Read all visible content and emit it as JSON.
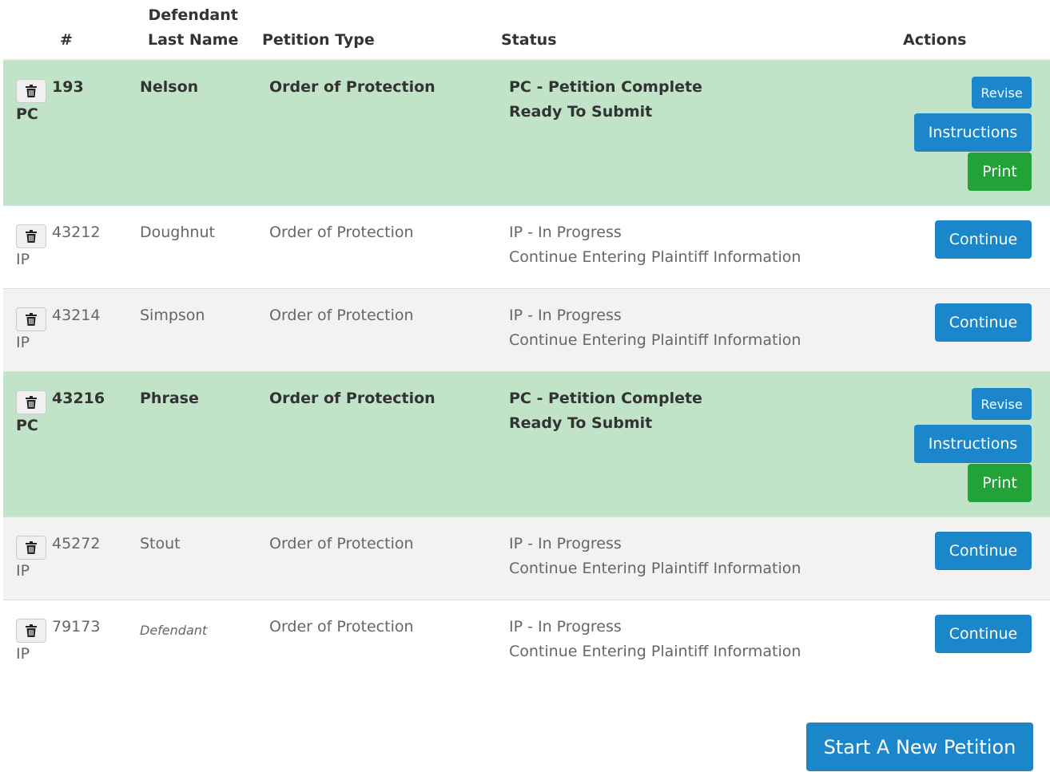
{
  "headers": {
    "num": "#",
    "defendant_line1": "Defendant",
    "defendant_line2": "Last Name",
    "petition_type": "Petition Type",
    "status": "Status",
    "actions": "Actions"
  },
  "icons": {
    "delete": "trash-icon"
  },
  "colors": {
    "complete_row": "#c1e4c8",
    "alt_row": "#f2f2f2",
    "button_blue": "#1b86c9",
    "button_green": "#22a338"
  },
  "rows": [
    {
      "id": "193",
      "code": "PC",
      "last_name": "Nelson",
      "petition_type": "Order of Protection",
      "status_line1": "PC - Petition Complete",
      "status_line2": "Ready To Submit",
      "actions": {
        "revise": "Revise",
        "instructions": "Instructions",
        "print": "Print"
      }
    },
    {
      "id": "43212",
      "code": "IP",
      "last_name": "Doughnut",
      "petition_type": "Order of Protection",
      "status_line1": "IP - In Progress",
      "status_line2": "Continue Entering Plaintiff Information",
      "actions": {
        "continue": "Continue"
      }
    },
    {
      "id": "43214",
      "code": "IP",
      "last_name": "Simpson",
      "petition_type": "Order of Protection",
      "status_line1": "IP - In Progress",
      "status_line2": "Continue Entering Plaintiff Information",
      "actions": {
        "continue": "Continue"
      }
    },
    {
      "id": "43216",
      "code": "PC",
      "last_name": "Phrase",
      "petition_type": "Order of Protection",
      "status_line1": "PC - Petition Complete",
      "status_line2": "Ready To Submit",
      "actions": {
        "revise": "Revise",
        "instructions": "Instructions",
        "print": "Print"
      }
    },
    {
      "id": "45272",
      "code": "IP",
      "last_name": "Stout",
      "petition_type": "Order of Protection",
      "status_line1": "IP - In Progress",
      "status_line2": "Continue Entering Plaintiff Information",
      "actions": {
        "continue": "Continue"
      }
    },
    {
      "id": "79173",
      "code": "IP",
      "last_name": "Defendant",
      "petition_type": "Order of Protection",
      "status_line1": "IP - In Progress",
      "status_line2": "Continue Entering Plaintiff Information",
      "actions": {
        "continue": "Continue"
      }
    }
  ],
  "footer": {
    "start_button": "Start A New Petition"
  }
}
